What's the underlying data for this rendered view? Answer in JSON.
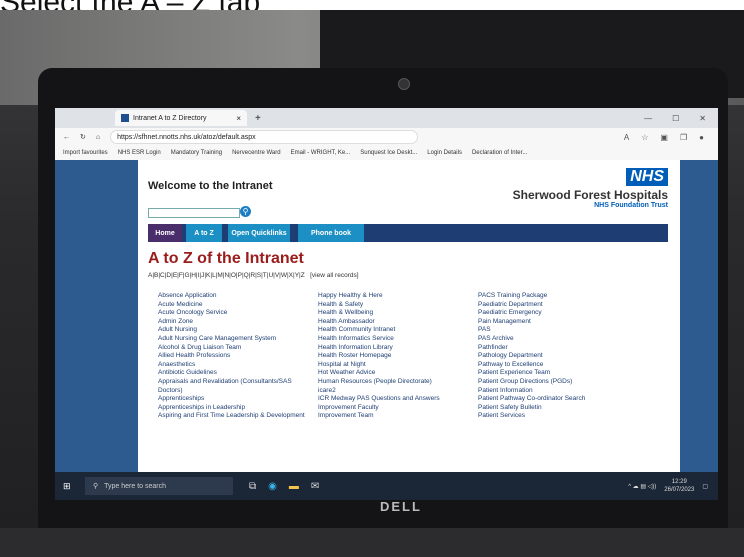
{
  "caption": "Select the A – Z tab",
  "browser": {
    "tab_title": "Intranet A to Z Directory",
    "tab_close": "×",
    "new_tab": "+",
    "url": "https://sfhnet.nnotts.nhs.uk/atoz/default.aspx",
    "favourites": [
      "Import favourites",
      "NHS ESR Login",
      "Mandatory Training",
      "Nervecentre Ward",
      "Email - WRIGHT, Ke...",
      "Sunquest Ice Deskt...",
      "Login Details",
      "Declaration of Inter..."
    ]
  },
  "header": {
    "welcome": "Welcome to the Intranet",
    "nhs_logo": "NHS",
    "trust_name": "Sherwood Forest Hospitals",
    "trust_sub": "NHS Foundation Trust"
  },
  "nav": {
    "home": "Home",
    "atoz": "A to Z",
    "quicklinks": "Open Quicklinks",
    "phonebook": "Phone book"
  },
  "atoz": {
    "heading": "A to Z of the Intranet",
    "letters": "A|B|C|D|E|F|G|H|I|J|K|L|M|N|O|P|Q|R|S|T|U|V|W|X|Y|Z",
    "view_all": "[view all records]",
    "col1": [
      "Absence Application",
      "Acute Medicine",
      "Acute Oncology Service",
      "Admin Zone",
      "Adult Nursing",
      "Adult Nursing Care Management System",
      "Alcohol & Drug Liaison Team",
      "Allied Health Professions",
      "Anaesthetics",
      "Antibiotic Guidelines",
      "Appraisals and Revalidation (Consultants/SAS Doctors)",
      "Apprenticeships",
      "Apprenticeships in Leadership",
      "Aspiring and First Time Leadership & Development"
    ],
    "col2": [
      "Happy Healthy & Here",
      "Health & Safety",
      "Health & Wellbeing",
      "Health Ambassador",
      "Health Community Intranet",
      "Health Informatics Service",
      "Health Information Library",
      "Health Roster Homepage",
      "Hospital at Night",
      "Hot Weather Advice",
      "Human Resources (People Directorate)",
      "icare2",
      "ICR Medway PAS Questions and Answers",
      "Improvement Faculty",
      "Improvement Team"
    ],
    "col3": [
      "PACS Training Package",
      "Paediatric Department",
      "Paediatric Emergency",
      "Pain Management",
      "PAS",
      "PAS Archive",
      "Pathfinder",
      "Pathology Department",
      "Pathway to Excellence",
      "Patient Experience Team",
      "Patient Group Directions (PGDs)",
      "Patient Information",
      "Patient Pathway Co-ordinator Search",
      "Patient Safety Bulletin",
      "Patient Services"
    ]
  },
  "taskbar": {
    "search_placeholder": "Type here to search",
    "time": "12:29",
    "date": "26/07/2023"
  },
  "laptop_brand": "DELL"
}
